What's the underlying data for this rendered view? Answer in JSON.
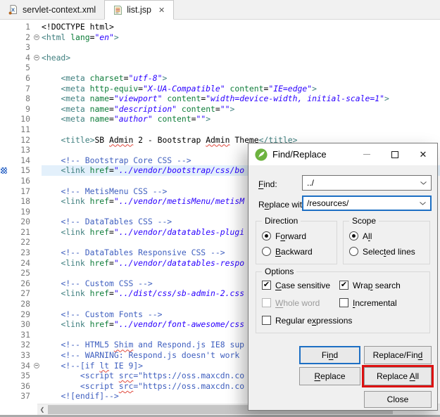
{
  "icons": {
    "close": "✕",
    "check": "✔",
    "left_arrow": "❮"
  },
  "tabs": {
    "items": [
      {
        "label": "servlet-context.xml",
        "icon": "xml-file-icon",
        "active": false
      },
      {
        "label": "list.jsp",
        "icon": "jsp-file-icon",
        "active": true
      }
    ]
  },
  "editor": {
    "current_line": 15,
    "marker_line": 15,
    "folded_lines": [
      2,
      4,
      34
    ],
    "colors": {
      "tag": "#3F7F7F",
      "attr": "#0e7d3a",
      "val": "#2A00FF",
      "comment": "#3F5FBF",
      "text": "#000000",
      "line_number": "#787878",
      "current_line_bg": "#E3F0FB",
      "marker": "#3b6cc7"
    },
    "lines": [
      {
        "n": 1,
        "ind": 0,
        "segs": [
          [
            "txt",
            "<!DOCTYPE html>"
          ]
        ]
      },
      {
        "n": 2,
        "ind": 0,
        "segs": [
          [
            "tag",
            "<html"
          ],
          [
            "attr",
            " lang"
          ],
          [
            "txt",
            "="
          ],
          [
            "val",
            "\"en\""
          ],
          [
            "tag",
            ">"
          ]
        ]
      },
      {
        "n": 3,
        "ind": 0,
        "segs": []
      },
      {
        "n": 4,
        "ind": 0,
        "segs": [
          [
            "tag",
            "<head>"
          ]
        ]
      },
      {
        "n": 5,
        "ind": 0,
        "segs": []
      },
      {
        "n": 6,
        "ind": 4,
        "segs": [
          [
            "tag",
            "<meta"
          ],
          [
            "attr",
            " charset"
          ],
          [
            "txt",
            "="
          ],
          [
            "val",
            "\"utf-8\""
          ],
          [
            "tag",
            ">"
          ]
        ]
      },
      {
        "n": 7,
        "ind": 4,
        "segs": [
          [
            "tag",
            "<meta"
          ],
          [
            "attr",
            " http-equiv"
          ],
          [
            "txt",
            "="
          ],
          [
            "val",
            "\"X-UA-Compatible\""
          ],
          [
            "attr",
            " content"
          ],
          [
            "txt",
            "="
          ],
          [
            "val",
            "\"IE=edge\""
          ],
          [
            "tag",
            ">"
          ]
        ]
      },
      {
        "n": 8,
        "ind": 4,
        "segs": [
          [
            "tag",
            "<meta"
          ],
          [
            "attr",
            " name"
          ],
          [
            "txt",
            "="
          ],
          [
            "val",
            "\"viewport\""
          ],
          [
            "attr",
            " content"
          ],
          [
            "txt",
            "="
          ],
          [
            "val",
            "\"width=device-width, initial-scale=1\""
          ],
          [
            "tag",
            ">"
          ]
        ]
      },
      {
        "n": 9,
        "ind": 4,
        "segs": [
          [
            "tag",
            "<meta"
          ],
          [
            "attr",
            " name"
          ],
          [
            "txt",
            "="
          ],
          [
            "val",
            "\"description\""
          ],
          [
            "attr",
            " content"
          ],
          [
            "txt",
            "="
          ],
          [
            "val",
            "\"\""
          ],
          [
            "tag",
            ">"
          ]
        ]
      },
      {
        "n": 10,
        "ind": 4,
        "segs": [
          [
            "tag",
            "<meta"
          ],
          [
            "attr",
            " name"
          ],
          [
            "txt",
            "="
          ],
          [
            "val",
            "\"author\""
          ],
          [
            "attr",
            " content"
          ],
          [
            "txt",
            "="
          ],
          [
            "val",
            "\"\""
          ],
          [
            "tag",
            ">"
          ]
        ]
      },
      {
        "n": 11,
        "ind": 0,
        "segs": []
      },
      {
        "n": 12,
        "ind": 4,
        "segs": [
          [
            "tag",
            "<title>"
          ],
          [
            "txt",
            "SB "
          ],
          [
            "txt",
            "Admin",
            1
          ],
          [
            "txt",
            " 2 - Bootstrap "
          ],
          [
            "txt",
            "Admin",
            1
          ],
          [
            "txt",
            " Theme"
          ],
          [
            "tag",
            "</title>"
          ]
        ]
      },
      {
        "n": 13,
        "ind": 0,
        "segs": []
      },
      {
        "n": 14,
        "ind": 4,
        "segs": [
          [
            "com",
            "<!-- Bootstrap Core CSS -->"
          ]
        ]
      },
      {
        "n": 15,
        "ind": 4,
        "segs": [
          [
            "tag",
            "<link"
          ],
          [
            "attr",
            " href"
          ],
          [
            "txt",
            "="
          ],
          [
            "val",
            "\"../vendor/bootstrap/css/bo"
          ]
        ]
      },
      {
        "n": 16,
        "ind": 0,
        "segs": []
      },
      {
        "n": 17,
        "ind": 4,
        "segs": [
          [
            "com",
            "<!-- MetisMenu CSS -->"
          ]
        ]
      },
      {
        "n": 18,
        "ind": 4,
        "segs": [
          [
            "tag",
            "<link"
          ],
          [
            "attr",
            " href"
          ],
          [
            "txt",
            "="
          ],
          [
            "val",
            "\"../vendor/metisMenu/metisM"
          ]
        ]
      },
      {
        "n": 19,
        "ind": 0,
        "segs": []
      },
      {
        "n": 20,
        "ind": 4,
        "segs": [
          [
            "com",
            "<!-- DataTables CSS -->"
          ]
        ]
      },
      {
        "n": 21,
        "ind": 4,
        "segs": [
          [
            "tag",
            "<link"
          ],
          [
            "attr",
            " href"
          ],
          [
            "txt",
            "="
          ],
          [
            "val",
            "\"../vendor/datatables-plugi"
          ]
        ]
      },
      {
        "n": 22,
        "ind": 0,
        "segs": []
      },
      {
        "n": 23,
        "ind": 4,
        "segs": [
          [
            "com",
            "<!-- DataTables Responsive CSS -->"
          ]
        ]
      },
      {
        "n": 24,
        "ind": 4,
        "segs": [
          [
            "tag",
            "<link"
          ],
          [
            "attr",
            " href"
          ],
          [
            "txt",
            "="
          ],
          [
            "val",
            "\"../vendor/datatables-respo"
          ]
        ]
      },
      {
        "n": 25,
        "ind": 0,
        "segs": []
      },
      {
        "n": 26,
        "ind": 4,
        "segs": [
          [
            "com",
            "<!-- Custom CSS -->"
          ]
        ]
      },
      {
        "n": 27,
        "ind": 4,
        "segs": [
          [
            "tag",
            "<link"
          ],
          [
            "attr",
            " href"
          ],
          [
            "txt",
            "="
          ],
          [
            "val",
            "\"../dist/css/sb-admin-2.css"
          ]
        ]
      },
      {
        "n": 28,
        "ind": 0,
        "segs": []
      },
      {
        "n": 29,
        "ind": 4,
        "segs": [
          [
            "com",
            "<!-- Custom Fonts -->"
          ]
        ]
      },
      {
        "n": 30,
        "ind": 4,
        "segs": [
          [
            "tag",
            "<link"
          ],
          [
            "attr",
            " href"
          ],
          [
            "txt",
            "="
          ],
          [
            "val",
            "\"../vendor/font-awesome/css"
          ]
        ]
      },
      {
        "n": 31,
        "ind": 0,
        "segs": []
      },
      {
        "n": 32,
        "ind": 4,
        "segs": [
          [
            "com",
            "<!-- HTML5 "
          ],
          [
            "com",
            "Shim",
            1
          ],
          [
            "com",
            " and Respond.js IE8 sup"
          ]
        ]
      },
      {
        "n": 33,
        "ind": 4,
        "segs": [
          [
            "com",
            "<!-- WARNING: Respond.js doesn't work"
          ]
        ]
      },
      {
        "n": 34,
        "ind": 4,
        "segs": [
          [
            "com",
            "<!--[if "
          ],
          [
            "com",
            "lt",
            1
          ],
          [
            "com",
            " IE 9]>"
          ]
        ]
      },
      {
        "n": 35,
        "ind": 8,
        "segs": [
          [
            "com",
            "<script "
          ],
          [
            "com",
            "src",
            1
          ],
          [
            "com",
            "=\"https://oss.maxcdn.co"
          ]
        ]
      },
      {
        "n": 36,
        "ind": 8,
        "segs": [
          [
            "com",
            "<script "
          ],
          [
            "com",
            "src",
            1
          ],
          [
            "com",
            "=\"https://oss.maxcdn.co"
          ]
        ]
      },
      {
        "n": 37,
        "ind": 4,
        "segs": [
          [
            "com",
            "<![endif]-->"
          ]
        ]
      }
    ]
  },
  "dialog": {
    "title": "Find/Replace",
    "accent_color": "#1d6fc4",
    "highlight_color": "#dd1111",
    "find": {
      "label": {
        "pre": "",
        "key": "F",
        "post": "ind:"
      },
      "value": "../"
    },
    "replace": {
      "label": {
        "pre": "R",
        "key": "e",
        "post": "place with:"
      },
      "value": "/resources/"
    },
    "direction": {
      "title": "Direction",
      "options": [
        {
          "label": {
            "pre": "F",
            "key": "o",
            "post": "rward"
          },
          "selected": true
        },
        {
          "label": {
            "pre": "",
            "key": "B",
            "post": "ackward"
          },
          "selected": false
        }
      ]
    },
    "scope": {
      "title": "Scope",
      "options": [
        {
          "label": {
            "pre": "A",
            "key": "l",
            "post": "l"
          },
          "selected": true
        },
        {
          "label": {
            "pre": "Selec",
            "key": "t",
            "post": "ed lines"
          },
          "selected": false
        }
      ]
    },
    "options": {
      "title": "Options",
      "checkboxes": [
        {
          "label": {
            "pre": "",
            "key": "C",
            "post": "ase sensitive"
          },
          "checked": true,
          "disabled": false
        },
        {
          "label": {
            "pre": "Wra",
            "key": "p",
            "post": " search"
          },
          "checked": true,
          "disabled": false
        },
        {
          "label": {
            "pre": "",
            "key": "W",
            "post": "hole word"
          },
          "checked": false,
          "disabled": true
        },
        {
          "label": {
            "pre": "",
            "key": "I",
            "post": "ncremental"
          },
          "checked": false,
          "disabled": false
        },
        {
          "label": {
            "pre": "Regular e",
            "key": "x",
            "post": "pressions"
          },
          "checked": false,
          "disabled": false
        }
      ]
    },
    "buttons": {
      "find": {
        "pre": "Fi",
        "key": "n",
        "post": "d"
      },
      "replace_find": {
        "pre": "Replace/Fin",
        "key": "d",
        "post": ""
      },
      "replace": {
        "pre": "",
        "key": "R",
        "post": "eplace"
      },
      "replace_all": {
        "pre": "Replace ",
        "key": "A",
        "post": "ll"
      },
      "close": {
        "pre": "Close",
        "key": "",
        "post": ""
      }
    }
  }
}
